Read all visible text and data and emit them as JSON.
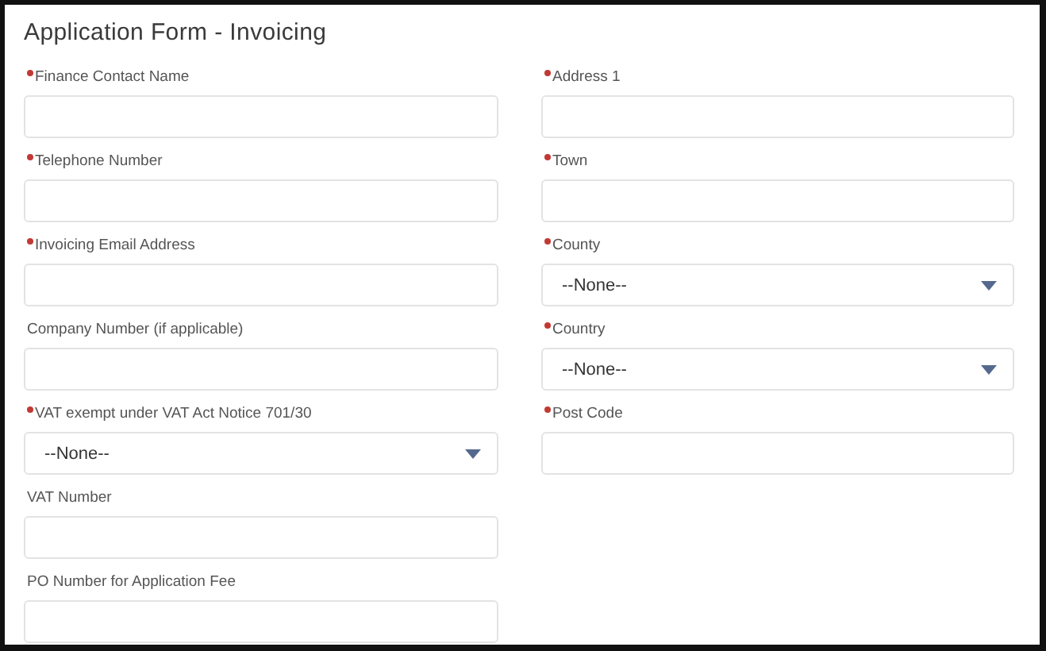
{
  "title": "Application Form - Invoicing",
  "columns": [
    [
      {
        "label": "Finance Contact Name",
        "required": true,
        "kind": "text"
      },
      {
        "label": "Telephone Number",
        "required": true,
        "kind": "text"
      },
      {
        "label": "Invoicing Email Address",
        "required": true,
        "kind": "text"
      },
      {
        "label": "Company Number (if applicable)",
        "required": false,
        "kind": "text"
      },
      {
        "label": "VAT exempt under VAT Act Notice 701/30",
        "required": true,
        "kind": "select",
        "value": "--None--"
      },
      {
        "label": "VAT Number",
        "required": false,
        "kind": "text"
      },
      {
        "label": "PO Number for Application Fee",
        "required": false,
        "kind": "text"
      }
    ],
    [
      {
        "label": "Address 1",
        "required": true,
        "kind": "text"
      },
      {
        "label": "Town",
        "required": true,
        "kind": "text"
      },
      {
        "label": "County",
        "required": true,
        "kind": "select",
        "value": "--None--"
      },
      {
        "label": "Country",
        "required": true,
        "kind": "select",
        "value": "--None--"
      },
      {
        "label": "Post Code",
        "required": true,
        "kind": "text"
      }
    ]
  ]
}
